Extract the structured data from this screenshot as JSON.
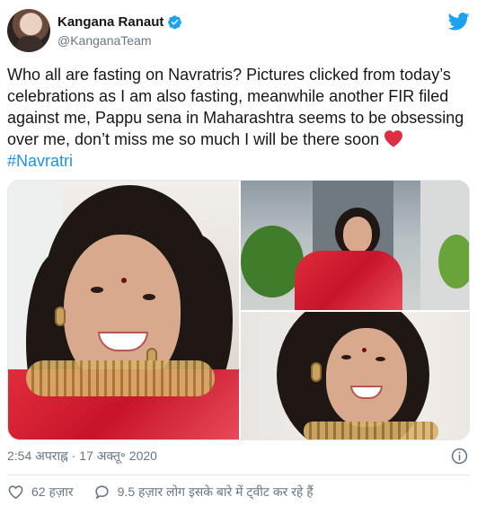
{
  "tweet": {
    "author": {
      "name": "Kangana Ranaut",
      "handle": "@KanganaTeam",
      "verified": true
    },
    "text_main": "Who all are fasting on Navratris? Pictures clicked from today’s celebrations as I am also fasting, meanwhile another FIR filed against me, Pappu sena in Maharashtra seems to be obsessing over me, don’t miss me so much I will be there soon ",
    "hashtag": "#Navratri",
    "timestamp": "2:54 अपराह्न · 17 अक्तू॰ 2020",
    "likes": "62 हज़ार",
    "replies_text": "9.5 हज़ार लोग इसके बारे में ट्वीट कर रहे हैं"
  },
  "icons": {
    "verified": "verified-badge-icon",
    "twitter": "twitter-bird-icon",
    "info": "info-icon",
    "like": "heart-outline-icon",
    "reply": "speech-bubble-icon",
    "emoji": "red-heart-emoji"
  },
  "colors": {
    "accent": "#1da1f2",
    "hashtag": "#1b95e0",
    "secondary_text": "#657786",
    "heart": "#dd2e44"
  }
}
